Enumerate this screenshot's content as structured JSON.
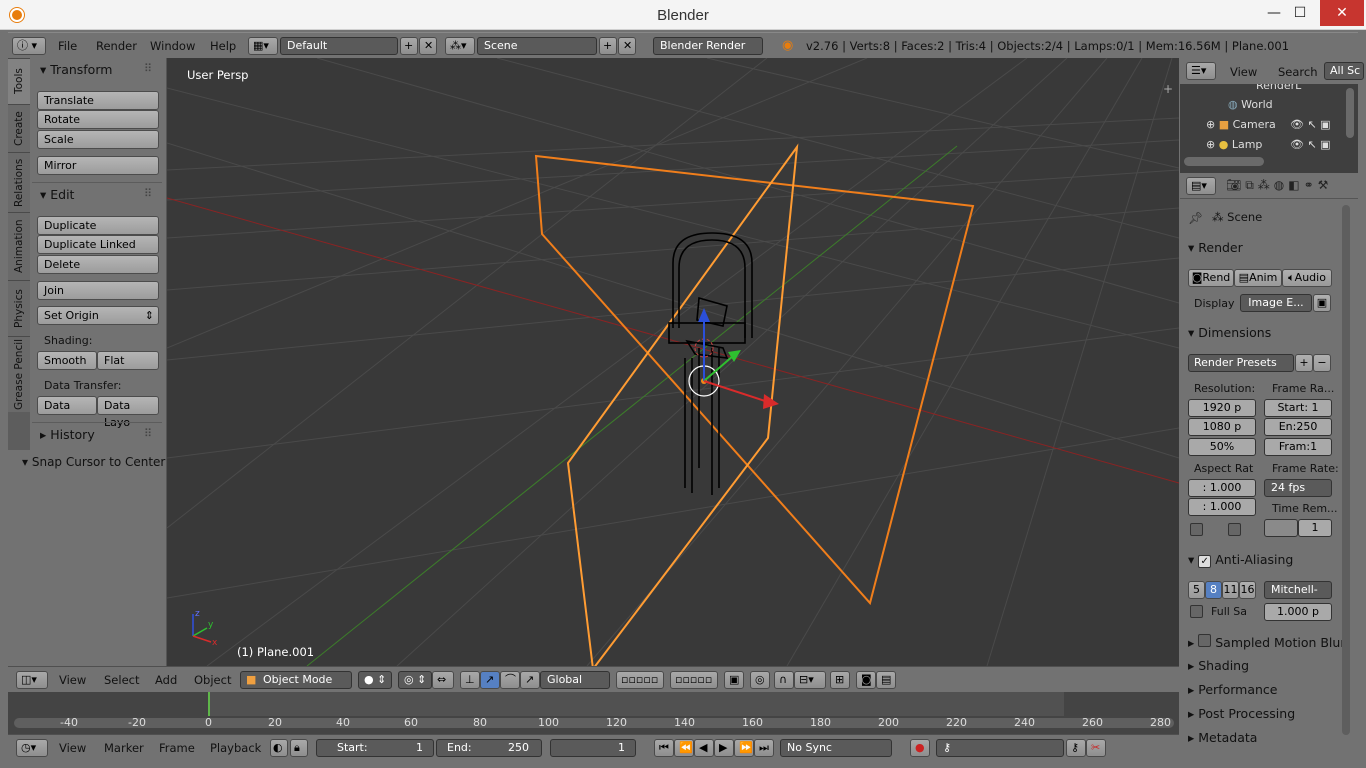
{
  "window": {
    "title": "Blender",
    "min": "—",
    "max": "☐",
    "close": "✕"
  },
  "infobar": {
    "menus": [
      "File",
      "Render",
      "Window",
      "Help"
    ],
    "layout": "Default",
    "scene": "Scene",
    "engine": "Blender Render",
    "stats": "v2.76 | Verts:8 | Faces:2 | Tris:4 | Objects:2/4 | Lamps:0/1 | Mem:16.56M | Plane.001"
  },
  "toolshelf": {
    "tabs": [
      "Tools",
      "Create",
      "Relations",
      "Animation",
      "Physics",
      "Grease Pencil"
    ],
    "transform_title": "Transform",
    "transform_buttons": [
      "Translate",
      "Rotate",
      "Scale",
      "Mirror"
    ],
    "edit_title": "Edit",
    "edit_buttons": [
      "Duplicate",
      "Duplicate Linked",
      "Delete",
      "Join"
    ],
    "set_origin": "Set Origin",
    "shading_label": "Shading:",
    "smooth": "Smooth",
    "flat": "Flat",
    "data_transfer_label": "Data Transfer:",
    "data": "Data",
    "data_layo": "Data Layo",
    "history_title": "History",
    "operator_title": "Snap Cursor to Center"
  },
  "viewport": {
    "view_label": "User Persp",
    "object_label": "(1) Plane.001"
  },
  "view3d_header": {
    "menus": [
      "View",
      "Select",
      "Add",
      "Object"
    ],
    "mode": "Object Mode",
    "orientation": "Global"
  },
  "timeline": {
    "ticks": [
      "-40",
      "-20",
      "0",
      "20",
      "40",
      "60",
      "80",
      "100",
      "120",
      "140",
      "160",
      "180",
      "200",
      "220",
      "240",
      "260",
      "280"
    ]
  },
  "timeline_header": {
    "menus": [
      "View",
      "Marker",
      "Frame",
      "Playback"
    ],
    "start_label": "Start:",
    "start_value": "1",
    "end_label": "End:",
    "end_value": "250",
    "current_frame": "1",
    "sync": "No Sync"
  },
  "outliner": {
    "menus": [
      "View",
      "Search"
    ],
    "filter": "All Sc",
    "items": [
      "RenderL",
      "World",
      "Camera",
      "Lamp"
    ]
  },
  "properties": {
    "scene_label": "Scene",
    "render_title": "Render",
    "render_buttons": [
      "Rend",
      "Anim",
      "Audio"
    ],
    "display_label": "Display",
    "display_value": "Image E...",
    "dimensions_title": "Dimensions",
    "render_presets": "Render Presets",
    "resolution_label": "Resolution:",
    "res_x": "1920 p",
    "res_y": "1080 p",
    "res_pct": "50%",
    "frame_range_label": "Frame Ra...",
    "frame_start": "Start: 1",
    "frame_end": "En:250",
    "frame_step": "Fram:1",
    "aspect_label": "Aspect Rat",
    "aspect_x": ": 1.000",
    "aspect_y": ": 1.000",
    "frame_rate_label": "Frame Rate:",
    "fps": "24 fps",
    "time_remap_label": "Time Rem...",
    "time_remap_value": "1",
    "aa_title": "Anti-Aliasing",
    "aa_samples": [
      "5",
      "8",
      "11",
      "16"
    ],
    "aa_filter": "Mitchell-",
    "full_sample": "Full Sa",
    "filter_size": "1.000 p",
    "collapsed_sections": [
      "Sampled Motion Blur",
      "Shading",
      "Performance",
      "Post Processing",
      "Metadata"
    ]
  }
}
